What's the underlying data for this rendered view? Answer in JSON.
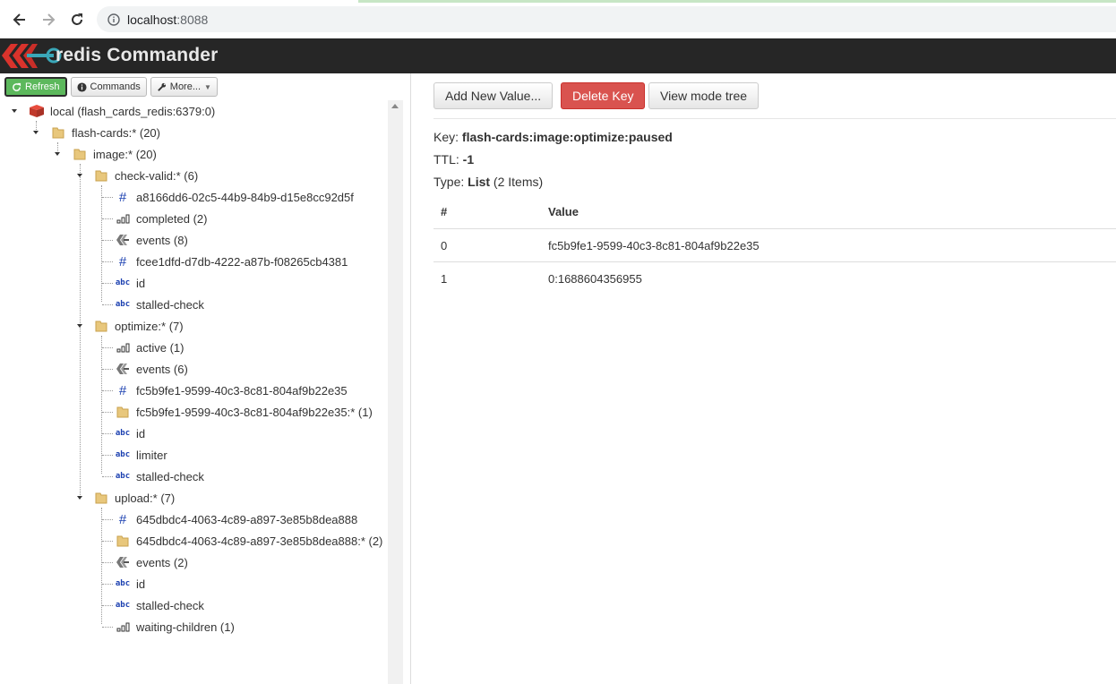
{
  "browser": {
    "url_host": "localhost",
    "url_port": ":8088"
  },
  "app": {
    "title": "redis Commander"
  },
  "toolbar": {
    "refresh_label": "Refresh",
    "commands_label": "Commands",
    "more_label": "More..."
  },
  "tree": {
    "root": "local (flash_cards_redis:6379:0)",
    "flash_cards": "flash-cards:* (20)",
    "image": "image:* (20)",
    "check_valid": {
      "label": "check-valid:* (6)",
      "items": [
        {
          "label": "a8166dd6-02c5-44b9-84b9-d15e8cc92d5f",
          "icon": "hash-icon"
        },
        {
          "label": "completed (2)",
          "icon": "zset-icon"
        },
        {
          "label": "events (8)",
          "icon": "stream-icon"
        },
        {
          "label": "fcee1dfd-d7db-4222-a87b-f08265cb4381",
          "icon": "hash-icon"
        },
        {
          "label": "id",
          "icon": "string-icon"
        },
        {
          "label": "stalled-check",
          "icon": "string-icon"
        }
      ]
    },
    "optimize": {
      "label": "optimize:* (7)",
      "items": [
        {
          "label": "active (1)",
          "icon": "zset-icon"
        },
        {
          "label": "events (6)",
          "icon": "stream-icon"
        },
        {
          "label": "fc5b9fe1-9599-40c3-8c81-804af9b22e35",
          "icon": "hash-icon"
        },
        {
          "label": "fc5b9fe1-9599-40c3-8c81-804af9b22e35:* (1)",
          "icon": "folder-icon"
        },
        {
          "label": "id",
          "icon": "string-icon"
        },
        {
          "label": "limiter",
          "icon": "string-icon"
        },
        {
          "label": "stalled-check",
          "icon": "string-icon"
        }
      ]
    },
    "upload": {
      "label": "upload:* (7)",
      "items": [
        {
          "label": "645dbdc4-4063-4c89-a897-3e85b8dea888",
          "icon": "hash-icon"
        },
        {
          "label": "645dbdc4-4063-4c89-a897-3e85b8dea888:* (2)",
          "icon": "folder-icon"
        },
        {
          "label": "events (2)",
          "icon": "stream-icon"
        },
        {
          "label": "id",
          "icon": "string-icon"
        },
        {
          "label": "stalled-check",
          "icon": "string-icon"
        },
        {
          "label": "waiting-children (1)",
          "icon": "zset-icon"
        }
      ]
    }
  },
  "actions": {
    "add_value": "Add New Value...",
    "delete_key": "Delete Key",
    "view_mode": "View mode tree"
  },
  "details": {
    "key_label": "Key:",
    "key_value": "flash-cards:image:optimize:paused",
    "ttl_label": "TTL:",
    "ttl_value": "-1",
    "type_label": "Type:",
    "type_value": "List",
    "type_count": "(2 Items)"
  },
  "table": {
    "headers": [
      "#",
      "Value"
    ],
    "rows": [
      [
        "0",
        "fc5b9fe1-9599-40c3-8c81-804af9b22e35"
      ],
      [
        "1",
        "0:1688604356955"
      ]
    ]
  },
  "colors": {
    "header_bg": "#262626",
    "refresh_green": "#5cb85c",
    "delete_red": "#d9534f",
    "icon_blue": "#1a3fb0"
  }
}
